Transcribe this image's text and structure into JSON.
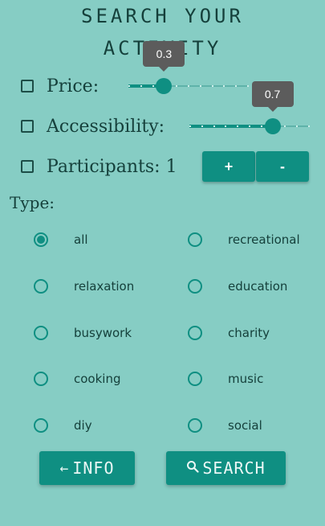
{
  "title": {
    "line1": "SEARCH YOUR",
    "line2": "ACTIVITY"
  },
  "filters": {
    "price": {
      "label": "Price:",
      "checked": false,
      "value": 0.3,
      "value_text": "0.3"
    },
    "accessibility": {
      "label": "Accessibility:",
      "checked": false,
      "value": 0.7,
      "value_text": "0.7"
    },
    "participants": {
      "label": "Participants: 1",
      "checked": false,
      "plus": "+",
      "minus": "-"
    }
  },
  "type": {
    "label": "Type:",
    "selected": "all",
    "options": [
      {
        "label": "all"
      },
      {
        "label": "recreational"
      },
      {
        "label": "relaxation"
      },
      {
        "label": "education"
      },
      {
        "label": "busywork"
      },
      {
        "label": "charity"
      },
      {
        "label": "cooking"
      },
      {
        "label": "music"
      },
      {
        "label": "diy"
      },
      {
        "label": "social"
      }
    ]
  },
  "buttons": {
    "info": {
      "icon": "arrow-left-icon",
      "label": "INFO"
    },
    "search": {
      "icon": "search-icon",
      "label": "SEARCH"
    }
  },
  "colors": {
    "background": "#86cdc4",
    "accent": "#0f8f82",
    "tooltip": "#5c5c5c"
  }
}
